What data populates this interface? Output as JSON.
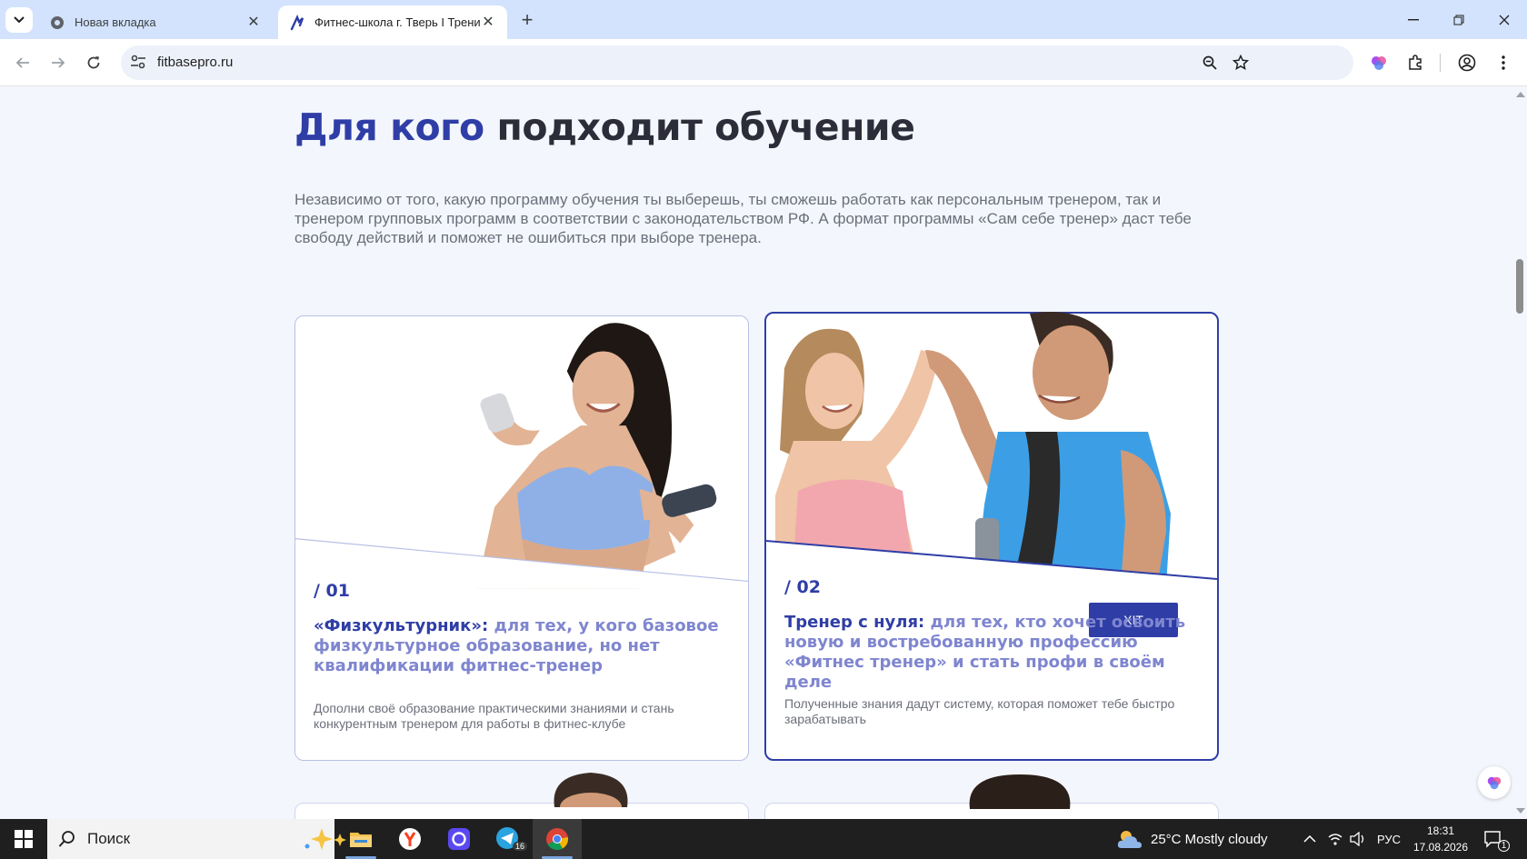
{
  "browser": {
    "tabs": [
      {
        "title": "Новая вкладка",
        "active": false
      },
      {
        "title": "Фитнес-школа г. Тверь I Трени",
        "active": true
      }
    ],
    "url": "fitbasepro.ru"
  },
  "page": {
    "heading_accent": "Для кого",
    "heading_rest": "подходит обучение",
    "intro": "Независимо от того, какую программу обучения ты выберешь, ты сможешь работать как персональным тренером, так и тренером групповых программ в соответствии с законодательством РФ. А формат программы «Сам себе тренер» даст тебе свободу действий и поможет не ошибиться при выборе тренера.",
    "cards": [
      {
        "number": "/ 01",
        "title_lead": "«Физкультурник»:",
        "title_rest": "для тех, у кого базовое физкультурное образование, но нет квалификации фитнес-тренер",
        "description": "Дополни своё образование практическими знаниями и стань конкурентным тренером для работы в фитнес-клубе"
      },
      {
        "number": "/ 02",
        "badge": "ХІТ",
        "title_lead": "Тренер с нуля:",
        "title_rest": "для тех, кто хочет освоить новую и востребованную профессию «Фитнес тренер» и стать профи в своём деле",
        "description": "Полученные знания дадут систему, которая поможет тебе быстро зарабатывать"
      }
    ]
  },
  "taskbar": {
    "search_placeholder": "Поиск",
    "weather": "25°C  Mostly cloudy",
    "language": "РУС",
    "time": "18:31",
    "date": "17.08.2026",
    "notifications": "1",
    "telegram_badge": "16"
  },
  "colors": {
    "brand_blue": "#2f3ea6",
    "brand_light": "#7f86cf",
    "page_bg": "#f3f6fc"
  }
}
